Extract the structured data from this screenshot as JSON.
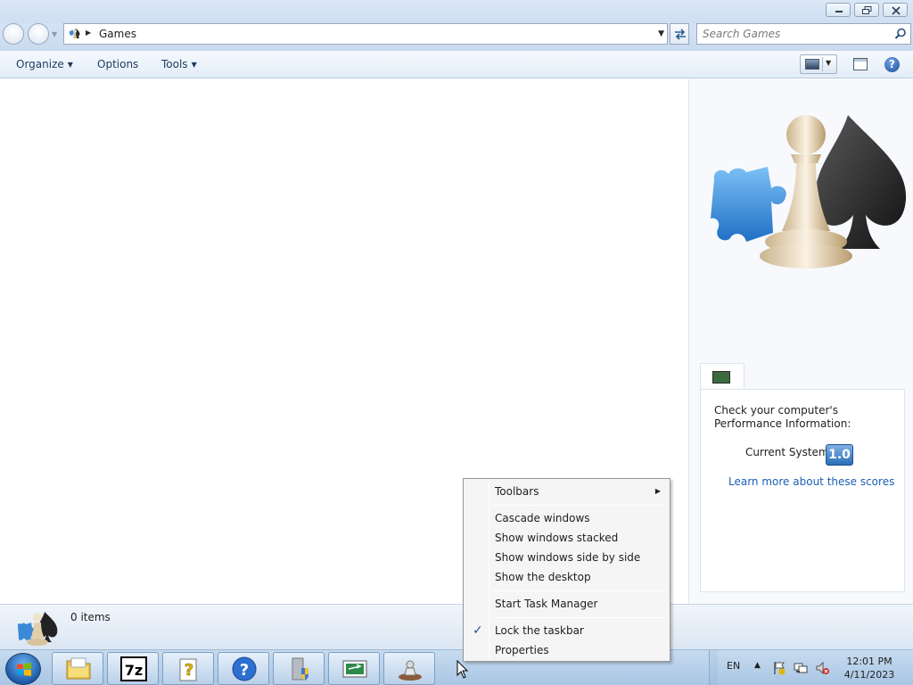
{
  "window": {
    "caption_buttons": [
      "minimize",
      "restore",
      "close"
    ]
  },
  "address": {
    "path": "Games",
    "search_placeholder": "Search Games"
  },
  "command_bar": {
    "organize": "Organize",
    "options": "Options",
    "tools": "Tools"
  },
  "preview": {
    "performance_heading": "Check your computer's Performance Information:",
    "current_system_label": "Current System",
    "score": "1.0",
    "learn_more": "Learn more about these scores"
  },
  "details": {
    "item_count": "0 items"
  },
  "context_menu": {
    "items": [
      {
        "label": "Toolbars",
        "submenu": true
      },
      {
        "label": "Cascade windows"
      },
      {
        "label": "Show windows stacked"
      },
      {
        "label": "Show windows side by side"
      },
      {
        "label": "Show the desktop"
      },
      {
        "label": "Start Task Manager"
      },
      {
        "label": "Lock the taskbar",
        "checked": true
      },
      {
        "label": "Properties"
      }
    ]
  },
  "taskbar": {
    "buttons": [
      "explorer-icon",
      "7zip-icon",
      "help-doc-icon",
      "help-icon",
      "security-icon",
      "display-icon",
      "games-icon"
    ],
    "seven_zip_label": "7z",
    "help_glyph": "?",
    "language": "EN",
    "time": "12:01 PM",
    "date": "4/11/2023"
  },
  "colors": {
    "link": "#1a5fb4",
    "accent": "#1c5aa8",
    "menu_bg": "#f5f5f5"
  }
}
